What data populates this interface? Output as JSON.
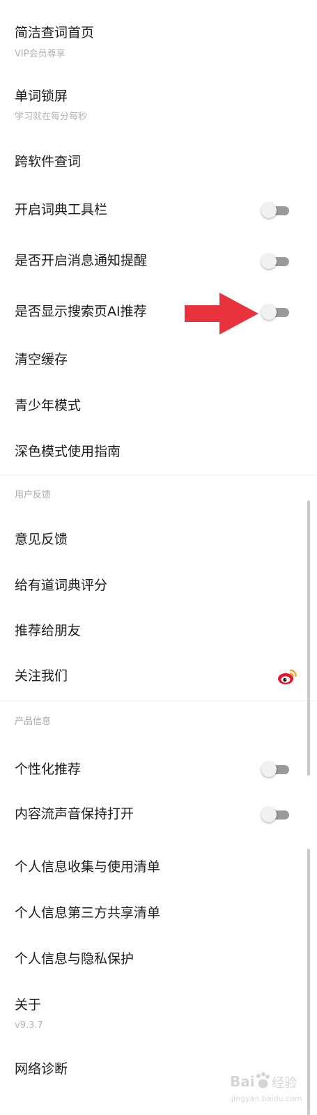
{
  "settings": {
    "items": [
      {
        "title": "简洁查词首页",
        "subtitle": "VIP会员尊享"
      },
      {
        "title": "单词锁屏",
        "subtitle": "学习就在每分每秒"
      },
      {
        "title": "跨软件查词"
      },
      {
        "title": "开启词典工具栏",
        "toggle": false
      },
      {
        "title": "是否开启消息通知提醒",
        "toggle": false
      },
      {
        "title": "是否显示搜索页AI推荐",
        "toggle": false
      },
      {
        "title": "清空缓存"
      },
      {
        "title": "青少年模式"
      },
      {
        "title": "深色模式使用指南"
      }
    ]
  },
  "feedback": {
    "section_label": "用户反馈",
    "items": [
      {
        "title": "意见反馈"
      },
      {
        "title": "给有道词典评分"
      },
      {
        "title": "推荐给朋友"
      },
      {
        "title": "关注我们",
        "icon": "weibo-icon"
      }
    ]
  },
  "product": {
    "section_label": "产品信息",
    "items": [
      {
        "title": "个性化推荐",
        "toggle": false
      },
      {
        "title": "内容流声音保持打开",
        "toggle": false
      },
      {
        "title": "个人信息收集与使用清单"
      },
      {
        "title": "个人信息第三方共享清单"
      },
      {
        "title": "个人信息与隐私保护"
      },
      {
        "title": "关于",
        "subtitle": "v9.3.7"
      },
      {
        "title": "网络诊断"
      }
    ]
  },
  "watermark": {
    "brand": "Bai",
    "brand_cn": "经验",
    "url": "jingyan.baidu.com"
  },
  "colors": {
    "arrow": "#e8323e",
    "toggle_track": "#9a9a9a",
    "toggle_knob": "#f1f1f1",
    "weibo": "#e6162d"
  }
}
